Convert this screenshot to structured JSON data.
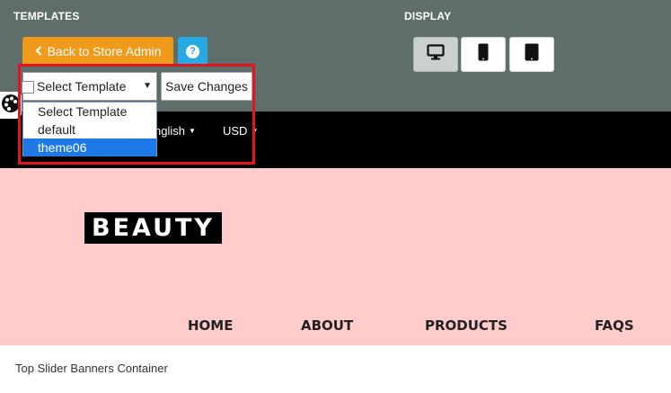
{
  "editor": {
    "templates_label": "TEMPLATES",
    "display_label": "DISPLAY",
    "back_button_label": "Back to Store Admin",
    "help_icon": "question-circle-icon",
    "devices": [
      {
        "name": "desktop-icon",
        "active": true
      },
      {
        "name": "phone-icon",
        "active": false
      },
      {
        "name": "tablet-icon",
        "active": false
      }
    ],
    "template_select": {
      "value": "Select Template",
      "options": [
        "Select Template",
        "default",
        "theme06"
      ],
      "highlighted_option": "theme06"
    },
    "save_button_label": "Save Changes"
  },
  "store": {
    "language_label": "nglish",
    "currency_label": "USD",
    "logo_text": "BEAUTY",
    "menu": [
      "HOME",
      "ABOUT",
      "PRODUCTS",
      "FAQS"
    ],
    "slider_caption": "Top Slider Banners Container"
  },
  "colors": {
    "toolbar_bg": "#5f6e6a",
    "back_button": "#ef9a1b",
    "help_button": "#27a9e3",
    "hero_bg": "#ffcbcb",
    "highlight_border": "#e3141b",
    "option_selected": "#1e78e6"
  }
}
